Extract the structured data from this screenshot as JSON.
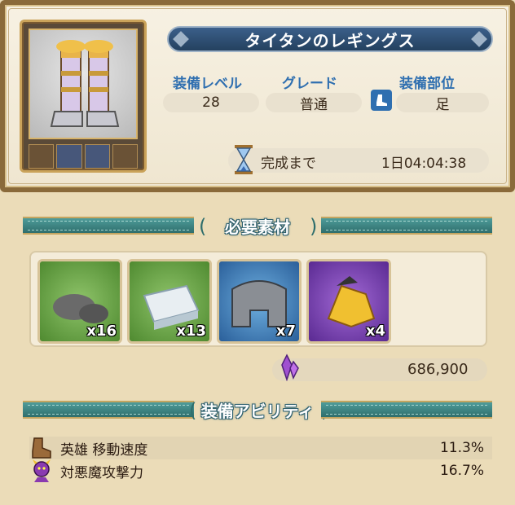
{
  "item": {
    "name": "タイタンのレギングス",
    "level_label": "装備レベル",
    "level_value": "28",
    "grade_label": "グレード",
    "grade_value": "普通",
    "part_label": "装備部位",
    "part_value": "足",
    "timer_label": "完成まで",
    "timer_value": "1日04:04:38",
    "slots": [
      "empty",
      "gem",
      "gem",
      "empty"
    ]
  },
  "materials": {
    "title": "必要素材",
    "items": [
      {
        "name": "stone",
        "color": "green",
        "qty": "x16"
      },
      {
        "name": "ore",
        "color": "green",
        "qty": "x13"
      },
      {
        "name": "metal-plate",
        "color": "blue",
        "qty": "x7"
      },
      {
        "name": "gold-ornament",
        "color": "purple",
        "qty": "x4"
      }
    ],
    "cost_icon": "purple-crystal-icon",
    "cost_value": "686,900"
  },
  "abilities": {
    "title": "装備アビリティ",
    "rows": [
      {
        "icon": "boot-icon",
        "name": "英雄 移動速度",
        "value": "11.3%"
      },
      {
        "icon": "demon-icon",
        "name": "対悪魔攻撃力",
        "value": "16.7%"
      }
    ]
  },
  "colors": {
    "accent_blue": "#2f6fb0",
    "title_bar": "#24415f",
    "section_teal": "#2f6e6c"
  }
}
